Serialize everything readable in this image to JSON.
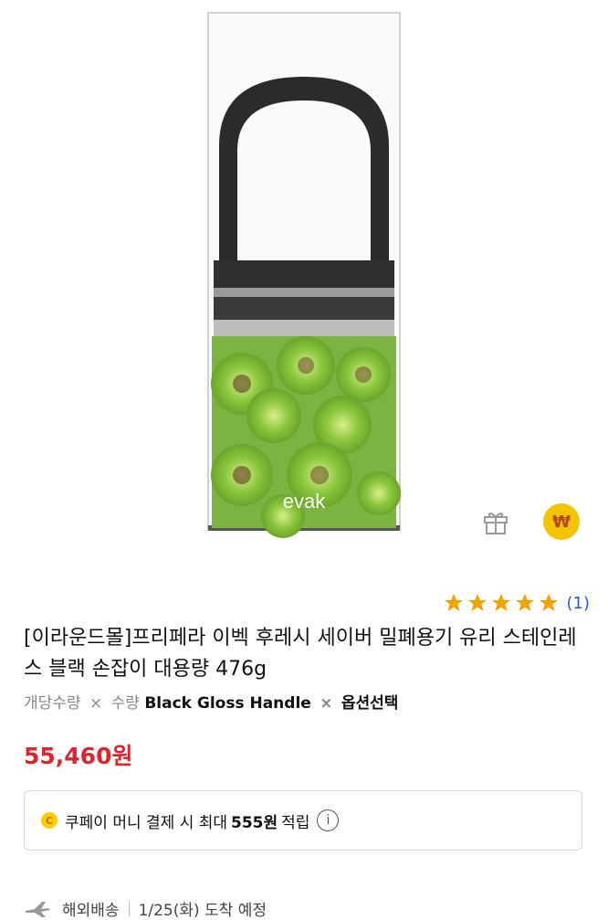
{
  "product": {
    "brand_logo_text": "evak",
    "rating_count": "(1)",
    "rating_value": 5,
    "title": "[이라운드몰]프리페라 이벡 후레시 세이버 밀폐용기 유리 스테인레스 블랙 손잡이 대용량 476g",
    "options": {
      "opt1": "개당수량",
      "opt2": "수량",
      "opt3": "Black Gloss Handle",
      "opt4": "옵션선택",
      "separator": "×"
    },
    "price": "55,460원"
  },
  "icons": {
    "gift": "gift-icon",
    "won": "won-coin-icon",
    "won_symbol": "₩",
    "star": "star-icon",
    "info": "info-icon",
    "coin_letter": "C",
    "plane": "airplane-icon"
  },
  "coupon": {
    "prefix": "쿠페이 머니 결제 시 최대",
    "amount": "555원",
    "suffix": "적립",
    "info": "i"
  },
  "shipping": {
    "type": "해외배송",
    "date": "1/25(화) 도착 예정"
  },
  "colors": {
    "price": "#e1222f",
    "star": "#f5a300",
    "link": "#2a5bd7",
    "won_badge": "#f5c400"
  }
}
